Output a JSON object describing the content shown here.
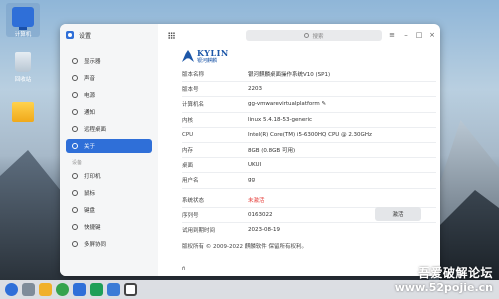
{
  "desktop": {
    "icons": [
      {
        "label": "计算机"
      },
      {
        "label": "回收站"
      },
      {
        "label": ""
      }
    ]
  },
  "window": {
    "title": "设置",
    "search_placeholder": "搜索"
  },
  "sidebar": {
    "items": [
      {
        "label": "显示器"
      },
      {
        "label": "声音"
      },
      {
        "label": "电源"
      },
      {
        "label": "通知"
      },
      {
        "label": "远程桌面"
      },
      {
        "label": "关于"
      }
    ],
    "section_devices": "设备",
    "device_items": [
      {
        "label": "打印机"
      },
      {
        "label": "鼠标"
      },
      {
        "label": "键盘"
      },
      {
        "label": "快捷键"
      },
      {
        "label": "多屏协同"
      }
    ]
  },
  "about": {
    "logo_text": "KYLIN",
    "logo_sub": "银河麒麟",
    "rows": [
      {
        "key": "版本名称",
        "value": "银河麒麟桌面操作系统V10 (SP1)"
      },
      {
        "key": "版本号",
        "value": "2203"
      },
      {
        "key": "计算机名",
        "value": "gg-vmwarevirtualplatform ✎"
      },
      {
        "key": "内核",
        "value": "linux 5.4.18-53-generic"
      },
      {
        "key": "CPU",
        "value": "Intel(R) Core(TM) i5-6300HQ CPU @ 2.30GHz"
      },
      {
        "key": "内存",
        "value": "8GB (0.8GB 可用)"
      },
      {
        "key": "桌面",
        "value": "UKUI"
      },
      {
        "key": "用户名",
        "value": "gg"
      }
    ],
    "activation_rows": [
      {
        "key": "系统状态",
        "value": "未激活"
      },
      {
        "key": "序列号",
        "value": "0163022"
      },
      {
        "key": "试用到期时间",
        "value": "2023-08-19"
      }
    ],
    "activate_button": "激活",
    "copyright": "版权所有 © 2009-2022 麒麟软件 保留所有权利。",
    "trailing_text": "ñ"
  },
  "watermark": {
    "cn": "吾爱破解论坛",
    "url": "www.52pojie.cn"
  },
  "colors": {
    "accent": "#2f6fd8",
    "status_red": "#e53935"
  }
}
